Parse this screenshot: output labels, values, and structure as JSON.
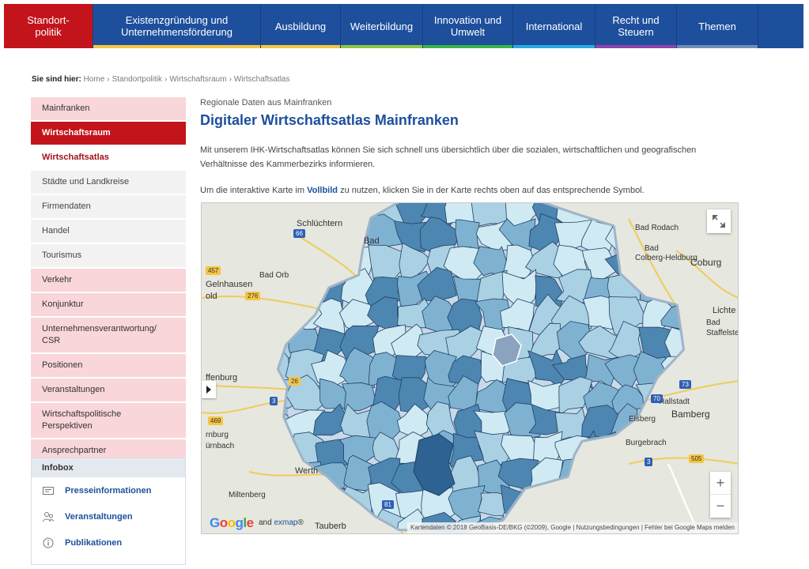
{
  "nav": [
    {
      "label": "Standort-\npolitik",
      "width": 113,
      "active": true,
      "stripe": "#c3141b"
    },
    {
      "label": "Existenzgründung und\nUnternehmensförderung",
      "width": 212,
      "stripe": "#f4c542"
    },
    {
      "label": "Ausbildung",
      "width": 101,
      "stripe": "#f4c542"
    },
    {
      "label": "Weiterbildung",
      "width": 104,
      "stripe": "#8dc63f"
    },
    {
      "label": "Innovation und\nUmwelt",
      "width": 114,
      "stripe": "#39b54a"
    },
    {
      "label": "International",
      "width": 104,
      "stripe": "#29abe2"
    },
    {
      "label": "Recht und\nSteuern",
      "width": 103,
      "stripe": "#8e44ad"
    },
    {
      "label": "Themen",
      "width": 103,
      "stripe": "#6b8fb8"
    }
  ],
  "breadcrumb": {
    "label": "Sie sind hier:",
    "items": [
      "Home",
      "Standortpolitik",
      "Wirtschaftsraum",
      "Wirtschaftsatlas"
    ],
    "sep": "›"
  },
  "sidebar": {
    "items": [
      {
        "label": "Mainfranken",
        "state": ""
      },
      {
        "label": "Wirtschaftsraum",
        "state": "active"
      },
      {
        "label": "Wirtschaftsatlas",
        "state": "current"
      },
      {
        "label": "Städte und Landkreise",
        "state": "sub"
      },
      {
        "label": "Firmendaten",
        "state": "sub"
      },
      {
        "label": "Handel",
        "state": "sub"
      },
      {
        "label": "Tourismus",
        "state": "sub"
      },
      {
        "label": "Verkehr",
        "state": ""
      },
      {
        "label": "Konjunktur",
        "state": ""
      },
      {
        "label": "Unternehmensverantwortung/\nCSR",
        "state": ""
      },
      {
        "label": "Positionen",
        "state": ""
      },
      {
        "label": "Veranstaltungen",
        "state": ""
      },
      {
        "label": "Wirtschaftspolitische\nPerspektiven",
        "state": ""
      },
      {
        "label": "Ansprechpartner",
        "state": ""
      }
    ]
  },
  "infobox": {
    "title": "Infobox",
    "links": [
      {
        "label": "Presseinformationen",
        "icon": "press-icon"
      },
      {
        "label": "Veranstaltungen",
        "icon": "people-icon"
      },
      {
        "label": "Publikationen",
        "icon": "info-icon"
      }
    ]
  },
  "main": {
    "kicker": "Regionale Daten aus Mainfranken",
    "title": "Digitaler Wirtschaftsatlas Mainfranken",
    "intro": "Mit unserem IHK-Wirtschaftsatlas können Sie sich schnell uns übersichtlich über die sozialen, wirtschaftlichen und geografischen Verhältnisse des Kammerbezirks informieren.",
    "hint_before": "Um die interaktive Karte im ",
    "hint_bold": "Vollbild",
    "hint_after": " zu nutzen, klicken Sie in der Karte rechts oben auf das entsprechende Symbol."
  },
  "map": {
    "place_labels": [
      "Schlüchtern",
      "Bad",
      "Bad Orb",
      "Gelnhausen",
      "old",
      "Bad Rodach",
      "Bad",
      "Colberg-Heldburg",
      "Coburg",
      "Lichte",
      "Bad",
      "Staffelstein",
      "ffenburg",
      "Hallstadt",
      "Bamberg",
      "Elsberg",
      "Burgebrach",
      "rnburg",
      "ürnbach",
      "Werth",
      "Miltenberg",
      "Tauberb"
    ],
    "road_labels": [
      "66",
      "457",
      "276",
      "26",
      "3",
      "469",
      "70",
      "73",
      "3",
      "505",
      "81"
    ],
    "zoom_in": "+",
    "zoom_out": "−",
    "logo": "Google",
    "exmap_prefix": "and ",
    "exmap_name": "exmap",
    "exmap_suffix": "®",
    "attribution": "Kartendaten © 2018 GeoBasis-DE/BKG (©2009), Google",
    "terms": "Nutzungsbedingungen",
    "report": "Fehler bei Google Maps melden",
    "colors": {
      "water_band": "#c8d9ea",
      "shade_1": "#cfeaf2",
      "shade_2": "#a9d1e3",
      "shade_3": "#7fb2d0",
      "shade_4": "#4d86b0",
      "shade_5": "#2d6292",
      "border": "#1f3f66"
    }
  }
}
